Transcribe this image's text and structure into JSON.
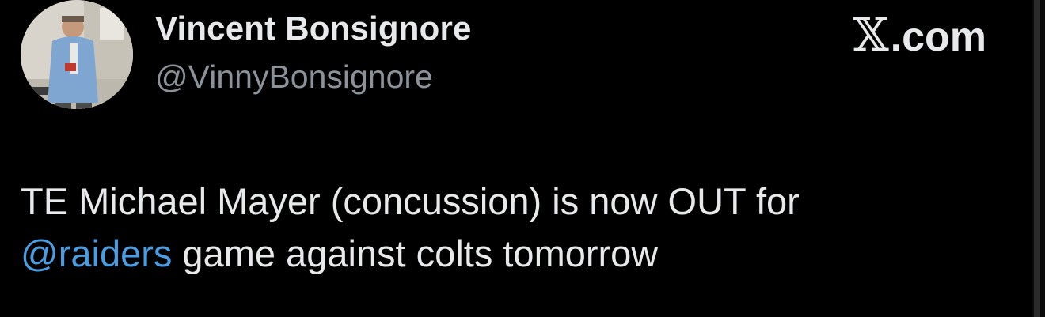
{
  "author": {
    "display_name": "Vincent Bonsignore",
    "handle": "@VinnyBonsignore",
    "avatar_icon": "profile-photo"
  },
  "brand": {
    "x_mark": "𝕏",
    "domain": ".com"
  },
  "tweet": {
    "line1": "TE Michael Mayer (concussion) is now OUT for",
    "mention": "@raiders",
    "line2_rest": " game against colts tomorrow"
  },
  "colors": {
    "background": "#000000",
    "text": "#e7e9ea",
    "secondary_text": "#8b9299",
    "link": "#4b9de2"
  }
}
